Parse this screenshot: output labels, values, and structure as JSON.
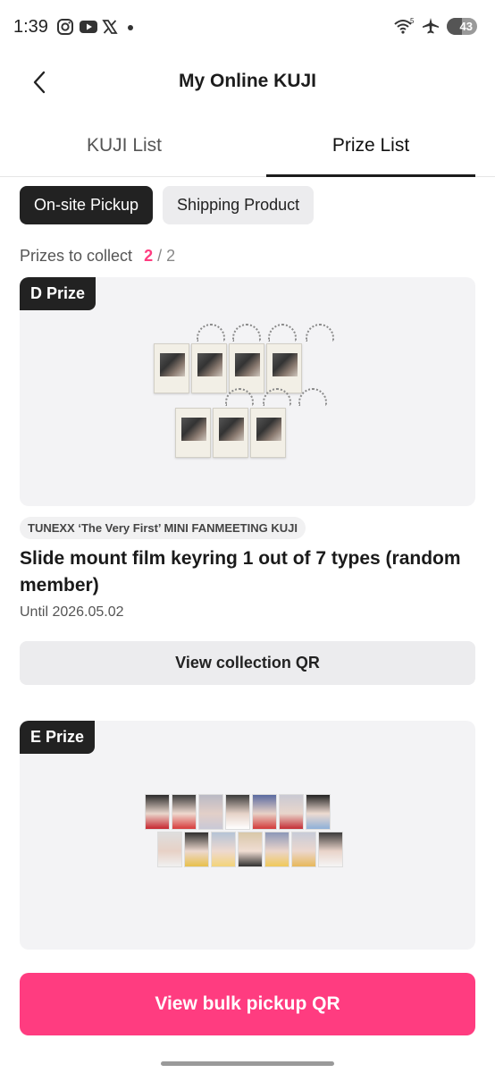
{
  "status": {
    "time": "1:39",
    "battery": "43",
    "icons": [
      "instagram-icon",
      "youtube-icon",
      "x-icon",
      "dot-icon",
      "wifi-icon",
      "airplane-icon",
      "battery-icon"
    ]
  },
  "header": {
    "title": "My Online KUJI"
  },
  "tabs": [
    {
      "label": "KUJI List",
      "active": false
    },
    {
      "label": "Prize List",
      "active": true
    }
  ],
  "chips": [
    {
      "label": "On-site Pickup",
      "active": true
    },
    {
      "label": "Shipping Product",
      "active": false
    }
  ],
  "collect": {
    "label": "Prizes to collect",
    "current": "2",
    "separator": "/",
    "total": "2"
  },
  "prizes": [
    {
      "badge": "D Prize",
      "event": "TUNEXX ‘The Very First’ MINI FANMEETING KUJI",
      "name": "Slide mount film keyring 1 out of 7 types (random member)",
      "until": "Until 2026.05.02",
      "qr_label": "View collection QR"
    },
    {
      "badge": "E Prize"
    }
  ],
  "bulk_button": "View bulk pickup QR",
  "colors": {
    "accent": "#ff3c80",
    "dark": "#222222",
    "chip_bg": "#ececee",
    "card_bg": "#f3f3f5"
  }
}
